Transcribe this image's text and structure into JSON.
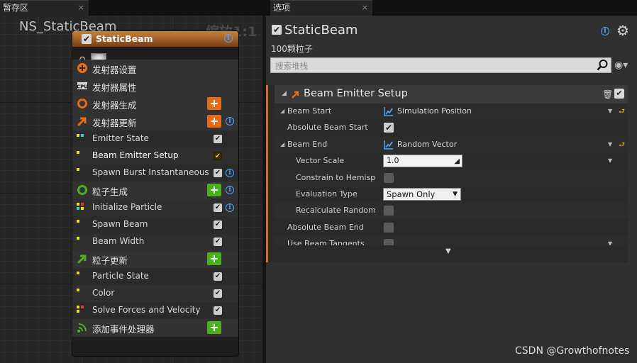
{
  "tabs": [
    {
      "label": "暂存区",
      "close": "×"
    },
    {
      "label": "选项",
      "close": "×"
    }
  ],
  "graph": {
    "title": "NS_StaticBeam",
    "zoom": "缩放1:1"
  },
  "node": {
    "name": "StaticBeam",
    "check": "✔",
    "items": [
      {
        "kind": "section",
        "label": "发射器设置",
        "icon": "emitter-settings-icon",
        "color": "#e56b17"
      },
      {
        "kind": "section",
        "label": "发射器属性",
        "icon": "cpu-icon",
        "color": "#d8d8d8"
      },
      {
        "kind": "section",
        "label": "发射器生成",
        "icon": "ring-icon",
        "color": "#e56b17",
        "add": "orange"
      },
      {
        "kind": "section",
        "label": "发射器更新",
        "icon": "arrow-icon",
        "color": "#e56b17",
        "add": "orange",
        "info": true
      },
      {
        "kind": "module",
        "label": "Emitter State",
        "dots": [
          "#e6e600",
          "#33cccc"
        ],
        "check": "✔"
      },
      {
        "kind": "module",
        "label": "Beam Emitter Setup",
        "dots": [
          "#e6e600"
        ],
        "check": "✔",
        "selected": true
      },
      {
        "kind": "module",
        "label": "Spawn Burst Instantaneous",
        "dots": [
          "#e6e600"
        ],
        "check": "✔",
        "info": true
      },
      {
        "kind": "section",
        "label": "粒子生成",
        "icon": "ring-icon",
        "color": "#4caf1d",
        "add": "green",
        "info": true
      },
      {
        "kind": "module",
        "label": "Initialize Particle",
        "dots": [
          "#e6e600",
          "#e0401c",
          "#33cccc",
          "#e6e600"
        ],
        "check": "✔",
        "info": true
      },
      {
        "kind": "module",
        "label": "Spawn Beam",
        "dots": [
          "#e6e600"
        ],
        "check": "✔"
      },
      {
        "kind": "module",
        "label": "Beam Width",
        "dots": [
          "#e6e600"
        ],
        "check": "✔"
      },
      {
        "kind": "section",
        "label": "粒子更新",
        "icon": "arrow-icon",
        "color": "#4caf1d",
        "add": "green"
      },
      {
        "kind": "module",
        "label": "Particle State",
        "dots": [
          "#e6e600"
        ],
        "check": "✔"
      },
      {
        "kind": "module",
        "label": "Color",
        "dots": [
          "#e6e600"
        ],
        "check": "✔"
      },
      {
        "kind": "module",
        "label": "Solve Forces and Velocity",
        "dots": [
          "#e6e600",
          "#e0401c",
          "#e6e600"
        ],
        "check": "✔"
      },
      {
        "kind": "section",
        "label": "添加事件处理器",
        "icon": "signal-icon",
        "color": "#4caf1d",
        "add": "green"
      }
    ]
  },
  "panel": {
    "title": "StaticBeam",
    "subtitle": "100颗粒子",
    "search_placeholder": "搜索堆栈",
    "section": {
      "title": "Beam Emitter Setup",
      "check": "✔",
      "rows": [
        {
          "label": "Beam Start",
          "type": "curve",
          "value": "Simulation Position",
          "expand": true,
          "drop": true,
          "reset": true
        },
        {
          "label": "Absolute Beam Start",
          "type": "check",
          "checked": true
        },
        {
          "label": "Beam End",
          "type": "curve",
          "value": "Random Vector",
          "expand": true,
          "drop": true,
          "reset": true
        },
        {
          "label": "Vector Scale",
          "type": "number",
          "value": "1.0",
          "indent": 2,
          "drop": true
        },
        {
          "label": "Constrain to Hemisphe",
          "type": "check",
          "checked": false,
          "indent": 2
        },
        {
          "label": "Evaluation Type",
          "type": "combo",
          "value": "Spawn Only",
          "indent": 2
        },
        {
          "label": "Recalculate Random E",
          "type": "check",
          "checked": false,
          "indent": 2
        },
        {
          "label": "Absolute Beam End",
          "type": "check",
          "checked": false
        },
        {
          "label": "Use Beam Tangents",
          "type": "check",
          "checked": false,
          "drop": true
        }
      ]
    }
  },
  "watermark": "CSDN @Growthofnotes",
  "colors": {
    "accent_orange": "#e56b17",
    "accent_green": "#4caf1d",
    "selection": "#d59b12",
    "info_blue": "#4fa3ff"
  }
}
